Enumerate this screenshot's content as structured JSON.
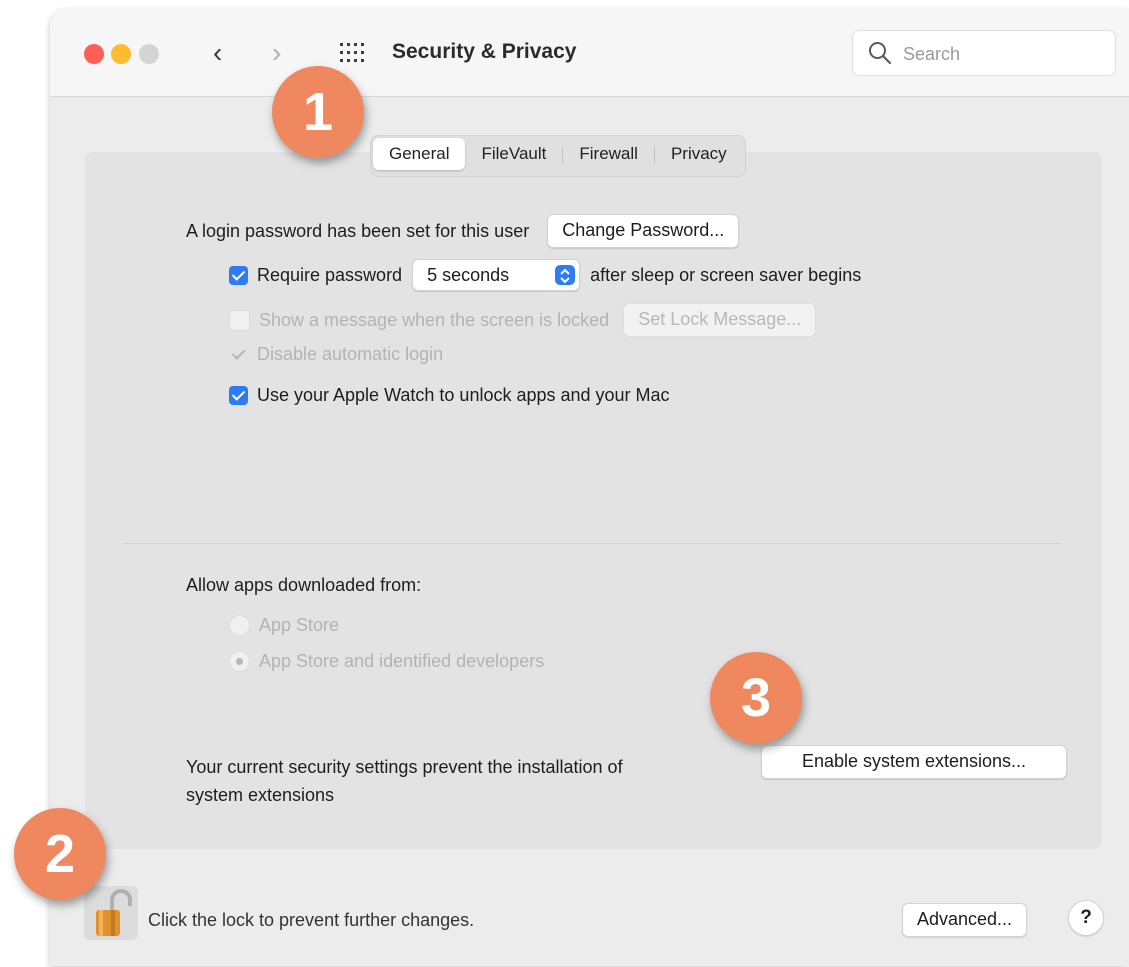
{
  "window": {
    "title": "Security & Privacy"
  },
  "toolbar": {
    "back_icon": "chevron-left",
    "forward_icon": "chevron-right",
    "grid_icon": "show-all-grid",
    "search_placeholder": "Search"
  },
  "tabs": [
    "General",
    "FileVault",
    "Firewall",
    "Privacy"
  ],
  "active_tab": "General",
  "general": {
    "login_text": "A login password has been set for this user",
    "change_password_button": "Change Password...",
    "require_password_label": "Require password",
    "require_password_checked": true,
    "require_password_value": "5 seconds",
    "require_password_suffix": "after sleep or screen saver begins",
    "show_message_label": "Show a message when the screen is locked",
    "show_message_checked": false,
    "set_lock_message_button": "Set Lock Message...",
    "disable_auto_login_label": "Disable automatic login",
    "disable_auto_login_checked": true,
    "apple_watch_label": "Use your Apple Watch to unlock apps and your Mac",
    "apple_watch_checked": true
  },
  "downloads": {
    "heading": "Allow apps downloaded from:",
    "options": [
      "App Store",
      "App Store and identified developers"
    ],
    "selected": "App Store and identified developers"
  },
  "extensions": {
    "message_line1": "Your current security settings prevent the installation of",
    "message_line2": "system extensions",
    "enable_button": "Enable system extensions..."
  },
  "footer": {
    "lock_text": "Click the lock to prevent further changes.",
    "advanced_button": "Advanced...",
    "help_button": "?"
  },
  "badges": [
    "1",
    "2",
    "3"
  ],
  "colors": {
    "badge": "#f0885f",
    "accent": "#2c7cf6",
    "close": "#fe5f57",
    "minimize": "#febc2e"
  }
}
